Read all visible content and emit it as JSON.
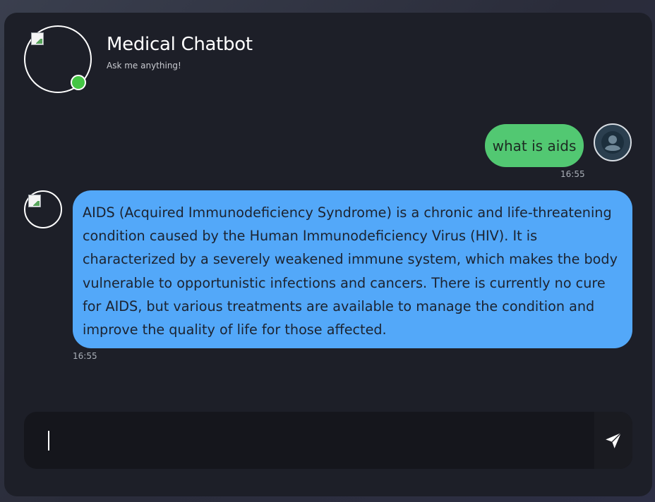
{
  "header": {
    "title": "Medical Chatbot",
    "subtitle": "Ask me anything!",
    "status_color": "#44c544",
    "avatar_icon": "broken-image-icon"
  },
  "messages": [
    {
      "sender": "user",
      "text": "what is aids",
      "time": "16:55",
      "bubble_color": "#52c872",
      "avatar_icon": "user-icon"
    },
    {
      "sender": "bot",
      "text": "AIDS (Acquired Immunodeficiency Syndrome) is a chronic and life-threatening condition caused by the Human Immunodeficiency Virus (HIV). It is characterized by a severely weakened immune system, which makes the body vulnerable to opportunistic infections and cancers. There is currently no cure for AIDS, but various treatments are available to manage the condition and improve the quality of life for those affected.",
      "time": "16:55",
      "bubble_color": "#53a8f9",
      "avatar_icon": "broken-image-icon"
    }
  ],
  "composer": {
    "value": "",
    "placeholder": "",
    "send_icon": "send-icon"
  },
  "colors": {
    "card_background": "#1d1f28",
    "input_background": "#15161c"
  }
}
